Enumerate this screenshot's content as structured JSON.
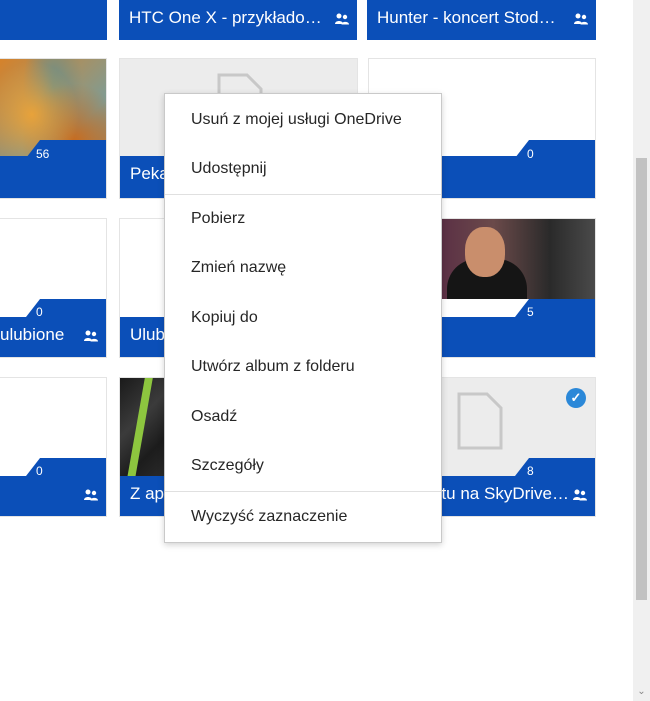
{
  "tiles_row0": [
    {
      "name": "HTC One X - przykłado…",
      "shared": true
    },
    {
      "name": "Hunter - koncert Stod…",
      "shared": true
    }
  ],
  "tiles_row1": [
    {
      "count": "56"
    },
    {
      "name": "Peka",
      "count": ""
    },
    {
      "count": "0"
    }
  ],
  "tiles_row2": [
    {
      "name": "ulubione",
      "count": "0",
      "shared": true
    },
    {
      "name": "Ulub",
      "count": ""
    },
    {
      "count": "5"
    }
  ],
  "tiles_row3": [
    {
      "count": "0",
      "shared": true
    },
    {
      "name": "Z ap",
      "count": ""
    },
    {
      "name": "tu na SkyDrive…",
      "count": "8",
      "shared": true,
      "selected": true
    }
  ],
  "context_menu": {
    "items": [
      "Usuń z mojej usługi OneDrive",
      "Udostępnij",
      "Pobierz",
      "Zmień nazwę",
      "Kopiuj do",
      "Utwórz album z folderu",
      "Osadź",
      "Szczegóły",
      "Wyczyść zaznaczenie"
    ]
  },
  "colors": {
    "band": "#0b4fb8",
    "accent_check": "#2b88d8"
  },
  "icons": [
    "shared-people-icon",
    "document-icon",
    "checkmark-icon",
    "scroll-down-arrow-icon"
  ]
}
